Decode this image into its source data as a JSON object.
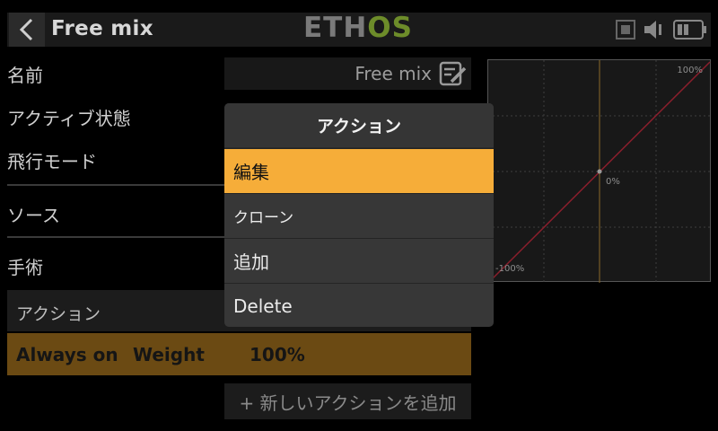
{
  "header": {
    "title": "Free mix",
    "logo_part1": "ETH",
    "logo_part2": "OS"
  },
  "form": {
    "name_label": "名前",
    "name_value": "Free mix",
    "active_state_label": "アクティブ状態",
    "flight_mode_label": "飛行モード",
    "source_label": "ソース",
    "operation_label": "手術"
  },
  "actions": {
    "header_label": "アクション",
    "row": {
      "condition": "Always on",
      "type": "Weight",
      "value": "100%"
    },
    "add_button": "+ 新しいアクションを追加"
  },
  "graph": {
    "max_label": "100%",
    "mid_label": "0%",
    "min_label": "-100%"
  },
  "menu": {
    "title": "アクション",
    "items": [
      {
        "label": "編集",
        "selected": true
      },
      {
        "label": "クローン",
        "selected": false
      },
      {
        "label": "追加",
        "selected": false
      },
      {
        "label": "Delete",
        "selected": false
      }
    ]
  },
  "colors": {
    "accent": "#f6ad39",
    "row_highlight": "#6b4a13",
    "logo_green": "#6d8c2a",
    "curve": "#8a1f2c"
  }
}
